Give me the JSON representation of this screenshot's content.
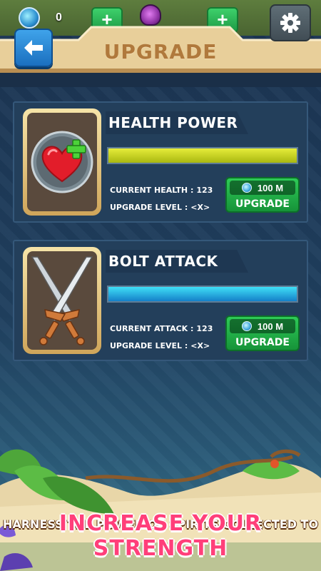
{
  "header": {
    "title": "UPGRADE"
  },
  "resources": {
    "gem_count": "0"
  },
  "cards": [
    {
      "title": "HEALTH POWER",
      "stat_label": "CURRENT HEALTH :",
      "stat_value": "123",
      "level_label": "UPGRADE LEVEL :",
      "level_value": "<X>",
      "cost": "100 M",
      "button_label": "UPGRADE",
      "icon": "heart-plus-icon",
      "bar_level": 1.0,
      "bar_color": "#d4de1c"
    },
    {
      "title": "BOLT ATTACK",
      "stat_label": "CURRENT ATTACK :",
      "stat_value": "123",
      "level_label": "UPGRADE LEVEL :",
      "level_value": "<X>",
      "cost": "100 M",
      "button_label": "UPGRADE",
      "icon": "crossed-swords-icon",
      "bar_level": 1.0,
      "bar_color": "#22c4e8"
    }
  ],
  "footer": {
    "line1": "HARNESS THE POWER OF SPIRITS COLLECTED TO",
    "line2": "INCREASE YOUR STRENGTH"
  }
}
